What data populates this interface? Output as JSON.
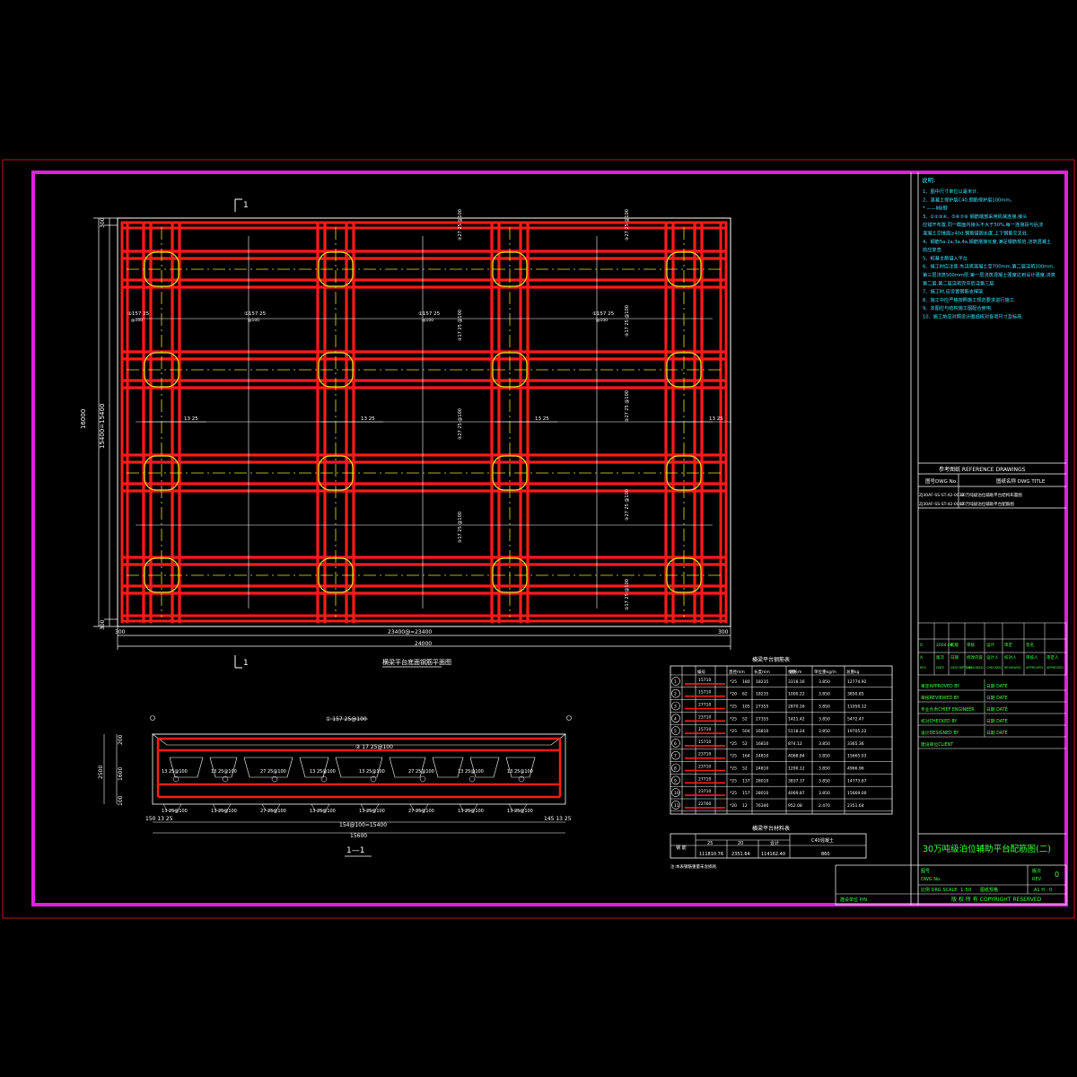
{
  "colors": {
    "background": "#000000",
    "frame_outer": "#c81414",
    "frame_magenta": "#e020e0",
    "rebar_red": "#ff1a1a",
    "axis_yellow": "#e8e800",
    "pile_circle": "#d8e020",
    "dimension_white": "#ffffff",
    "note_cyan": "#40e0ff",
    "title_green": "#40ff40",
    "table_cyan": "#60e0ff"
  },
  "section_mark": {
    "label": "1"
  },
  "plan": {
    "title": "横梁平台底面钢筋平面图",
    "dim_left_total": "16000",
    "dim_left_sub": "15400=15400",
    "dim_left_top": "300",
    "dim_left_bottom": "300",
    "dim_bottom_total": "24000",
    "dim_bottom_sub": "23400@=23400",
    "dim_bottom_left": "300",
    "dim_bottom_right": "300",
    "bar_labels_h": [
      "①157 25 @100",
      "①157 25 @100",
      "①157 25 @100",
      "①157 25 @100"
    ],
    "bar_labels_mid": [
      "13 25 @100",
      "13 25 @100",
      "13 25 @100",
      "13 25 @100"
    ],
    "bar_labels_v": [
      "②27 25 @100",
      "②17 25 @100",
      "②27 25 @100",
      "②17 25 @100",
      "②27 25 @100",
      "②17 25 @100",
      "②27 25 @100"
    ]
  },
  "section": {
    "title": "1—1",
    "dim_bottom_total": "15600",
    "dim_bottom_sub": "154@100=15400",
    "dim_left": "2500",
    "dim_left_top": "200",
    "dim_left_bottom": "100",
    "dim_left_mid": "1600",
    "top_bar": "① 157 25@100",
    "second_bar": "② 17 25@100",
    "stirrups_top": [
      "13 25@100",
      "13 25@100",
      "27 25@100",
      "13 25@100",
      "13 25@100",
      "27 25@100",
      "13 25@100",
      "13 25@100"
    ],
    "stirrups_bottom": [
      "13 25@100",
      "13 25@100",
      "27 25@100",
      "13 25@100",
      "13 25@100",
      "27 25@100",
      "13 25@100",
      "13 25@100"
    ],
    "dim_corner_left": "150 13 25",
    "dim_corner_right": "145 13 25"
  },
  "rebar_table": {
    "title": "横梁平台钢筋表",
    "headers": [
      "编号",
      "直径mm",
      "长度mm",
      "根数",
      "总长m",
      "单位重kg/m",
      "总重kg"
    ],
    "rows": [
      [
        "1",
        "15710",
        "25",
        "180",
        "18235",
        "3318.16",
        "3.850",
        "12774.92"
      ],
      [
        "2",
        "15710",
        "20",
        "62",
        "18235",
        "1000.22",
        "3.850",
        "3850.85"
      ],
      [
        "3",
        "27710",
        "25",
        "105",
        "27355",
        "2870.16",
        "3.850",
        "11050.12"
      ],
      [
        "4",
        "23710",
        "25",
        "52",
        "27355",
        "1421.42",
        "3.850",
        "5472.47"
      ],
      [
        "5",
        "15710",
        "25",
        "504",
        "16810",
        "5118.24",
        "3.850",
        "19705.22"
      ],
      [
        "6",
        "15710",
        "25",
        "52",
        "16810",
        "874.12",
        "3.850",
        "3365.36"
      ],
      [
        "7",
        "23710",
        "25",
        "164",
        "24810",
        "4068.84",
        "3.850",
        "15665.03"
      ],
      [
        "8",
        "23710",
        "25",
        "52",
        "24810",
        "1290.12",
        "3.850",
        "4966.96"
      ],
      [
        "9",
        "27710",
        "25",
        "137",
        "28010",
        "3837.37",
        "3.850",
        "14773.87"
      ],
      [
        "10",
        "23710",
        "25",
        "157",
        "28010",
        "4069.87",
        "3.850",
        "15669.00"
      ],
      [
        "11",
        "22760",
        "20",
        "12",
        "76340",
        "952.08",
        "2.470",
        "2351.64"
      ]
    ]
  },
  "material_table": {
    "title": "横梁平台材料表",
    "row_label": "钢 筋",
    "headers": [
      "25",
      "20",
      "合计",
      "C40混凝土"
    ],
    "values": [
      "111810.76",
      "2351.64",
      "114162.40",
      "860"
    ],
    "note": "注:本表钢筋重量未含损耗."
  },
  "notes": {
    "heading": "说明:",
    "items": [
      "1、图中尺寸单位以毫米计.",
      "2、混凝土保护层C40,钢筋保护层100mm。",
      "   * ——Ⅱ级钢",
      "3、①②③④、⑤⑥⑦⑧    钢筋端部采用机械连接,接头",
      "   应错开布置,同一截面内接头不大于50%,每一连接段与后浇",
      "   混凝土交接面≥40d,钢筋锚固长度,上下钢筋交叉处,",
      "4、钢筋5a-2a,3a,4a,钢筋搭接长度,满足钢筋规范,浇筑混凝土",
      "   前应复查.",
      "5、桩基主筋锚入平台.",
      "6、施工时应注意:先浇筑混凝土至700mm,第二层浇筑300mm,",
      "   第三层浇筑500mm厚;第一层浇筑混凝土强度达到设计强度,浇筑",
      "   第二层,第二层浇筑完毕后浇第三层.",
      "7、施工时,应设置钢筋支撑架.",
      "8、施工中应严格按照施工规范要求进行施工.",
      "9、本图应与结构施工图配合使用.",
      "10、施工前应对照设计图纸核对各项尺寸及标高."
    ]
  },
  "reference": {
    "heading": "参考图纸 REFERENCE DRAWINGS",
    "col1": "图号DWG No.",
    "col2": "图纸名称 DWG TITLE",
    "rows": [
      [
        "ZJ30AF-SS-ST-42-0032",
        "30万吨级泊位辅助平台结构布置图"
      ],
      [
        "ZJ30AF-SS-ST-42-0047",
        "30万吨级泊位辅助平台配筋图"
      ]
    ]
  },
  "revision": {
    "row1": [
      "0",
      "2004.06",
      "初版",
      "审核",
      "设计",
      "审定",
      "签名"
    ],
    "row2": [
      "A",
      "版次",
      "日期",
      "修改内容",
      "设计人",
      "校对人",
      "审核人",
      "审定人"
    ],
    "row3": [
      "REV",
      "DATE",
      "DESCRIPTION",
      "DESIGNED",
      "CHECKED",
      "REVIEWED",
      "APPROVED",
      "APPROVED"
    ]
  },
  "signatures": [
    [
      "审定APPROVED BY",
      "日期 DATE"
    ],
    [
      "审核REVIEWED BY",
      "日期 DATE"
    ],
    [
      "专业负责CHIEF ENGINEER",
      "日期 DATE"
    ],
    [
      "校对CHECKED BY",
      "日期 DATE"
    ],
    [
      "设计DESIGNED BY",
      "日期 DATE"
    ],
    [
      "建设单位CLIENT",
      ""
    ]
  ],
  "title_block": {
    "drawing_title": "30万吨级泊位辅助平台配筋图(二)",
    "dwg_no_label": "图号",
    "dwg_no_en": "DWG No.",
    "rev_label": "版次",
    "rev_en": "REV.",
    "rev_value": "0",
    "scale_label": "比例 DRG SCALE",
    "scale_value": "1:50",
    "sheet_label": "图纸规格",
    "sheet_value": "A1 H : 0",
    "copyright": "版 权 所 有  COPYRIGHT RESERVED",
    "bottom_left": "建设单位 P/N"
  }
}
